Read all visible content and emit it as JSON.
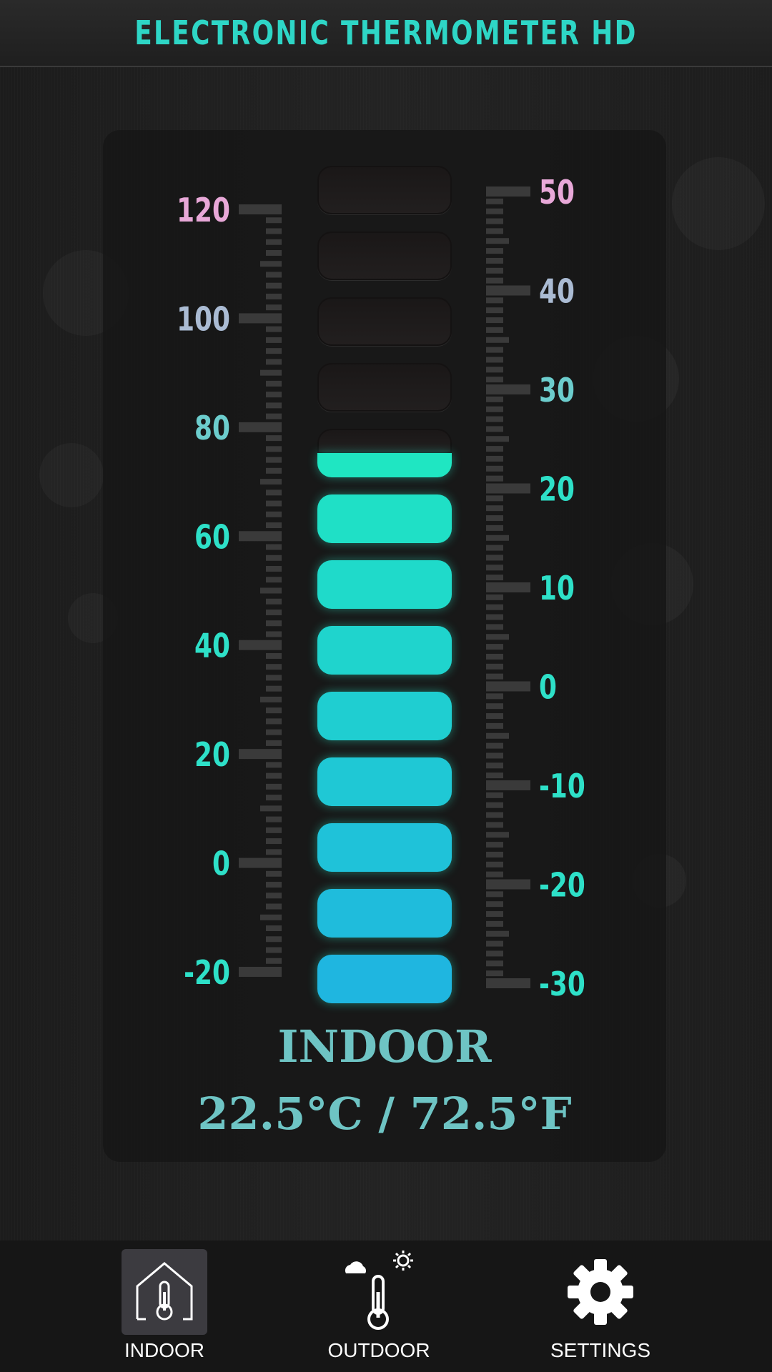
{
  "header": {
    "title": "ELECTRONIC THERMOMETER HD"
  },
  "thermometer": {
    "fahrenheit_labels": [
      "120",
      "100",
      "80",
      "60",
      "40",
      "20",
      "0",
      "-20"
    ],
    "celsius_labels": [
      "50",
      "40",
      "30",
      "20",
      "10",
      "0",
      "-10",
      "-20",
      "-30"
    ],
    "segments_total": 13,
    "segments_lit": 8.5,
    "colors": {
      "lit_top": "#1fe6c2",
      "lit_bottom": "#1fb6e0",
      "unlit": "#1f1c1c",
      "label_hot": "#e8a8d8",
      "label_cold": "#2ee0c8"
    }
  },
  "reading": {
    "mode": "INDOOR",
    "temperature": "22.5°C / 72.5°F"
  },
  "nav": {
    "items": [
      {
        "label": "INDOOR",
        "icon": "house-thermometer-icon",
        "active": true
      },
      {
        "label": "OUTDOOR",
        "icon": "weather-thermometer-icon",
        "active": false
      },
      {
        "label": "SETTINGS",
        "icon": "gear-icon",
        "active": false
      }
    ]
  }
}
